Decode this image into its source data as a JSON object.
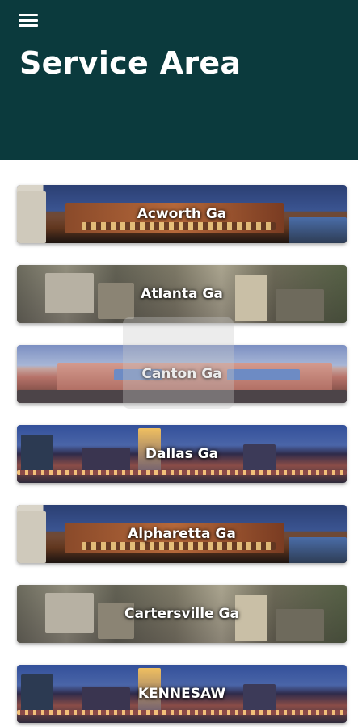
{
  "header": {
    "title": "Service Area",
    "menu_icon": "hamburger-menu-icon",
    "background": "#0b3a3d"
  },
  "service_areas": [
    {
      "label": "Acworth Ga",
      "scene": "store"
    },
    {
      "label": "Atlanta Ga",
      "scene": "aerial"
    },
    {
      "label": "Canton Ga",
      "scene": "mall"
    },
    {
      "label": "Dallas Ga",
      "scene": "skyline"
    },
    {
      "label": "Alpharetta Ga",
      "scene": "store"
    },
    {
      "label": "Cartersville Ga",
      "scene": "aerial"
    },
    {
      "label": "KENNESAW",
      "scene": "skyline"
    }
  ]
}
